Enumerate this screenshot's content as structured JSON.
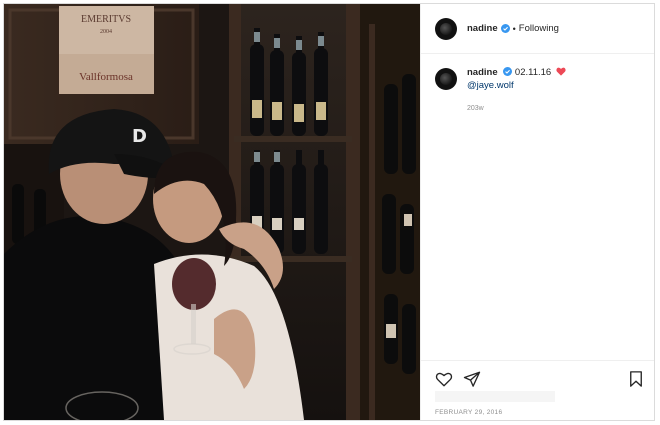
{
  "post": {
    "image_text": {
      "label_top": "EMERITVS",
      "label_year": "2004",
      "label_brand": "Vallformosa",
      "cap_logo": "D"
    }
  },
  "header": {
    "username": "nadine",
    "separator": "•",
    "follow_status": "Following"
  },
  "caption": {
    "username": "nadine",
    "text": "02.11.16",
    "mention": "@jaye.wolf",
    "age": "203w"
  },
  "actions": {
    "icons": [
      "heart-icon",
      "share-icon",
      "bookmark-icon"
    ]
  },
  "footer": {
    "date": "FEBRUARY 29, 2016"
  },
  "colors": {
    "verified": "#3897f0",
    "heart": "#ed4956",
    "mention": "#00376b",
    "muted": "#8e8e8e"
  }
}
